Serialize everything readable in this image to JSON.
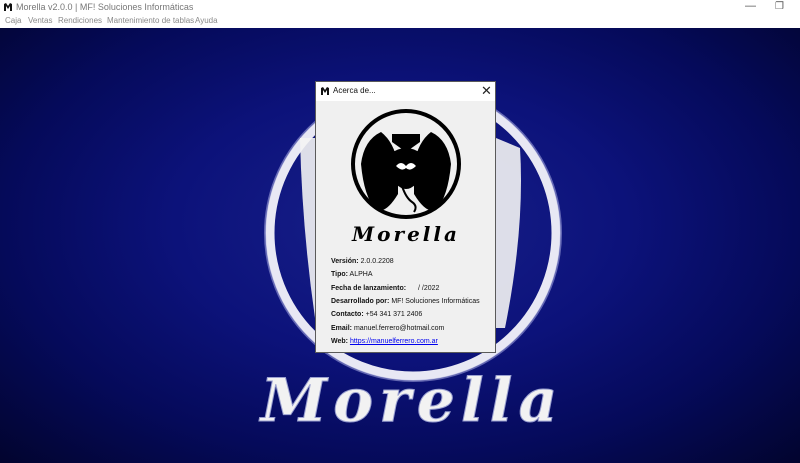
{
  "window": {
    "title": "Morella v2.0.0    |    MF! Soluciones Informáticas",
    "minimize_glyph": "—",
    "maximize_glyph": "❐"
  },
  "menu": [
    {
      "label": "Caja"
    },
    {
      "label": "Ventas"
    },
    {
      "label": "Rendiciones"
    },
    {
      "label": "Mantenimiento de tablas"
    },
    {
      "label": "Ayuda"
    }
  ],
  "background": {
    "brand_text": "Morella",
    "colors": {
      "blue_center": "#18208a",
      "blue_edge": "#02042e",
      "ring": "#ffffff"
    }
  },
  "dialog": {
    "title": "Acerca de...",
    "close_glyph": "✕",
    "logo_text": "Morella",
    "fields": [
      {
        "label": "Versión:",
        "value": "2.0.0.2208"
      },
      {
        "label": "Tipo:",
        "value": "ALPHA"
      },
      {
        "label": "Fecha de lanzamiento:",
        "value": "/      /2022"
      },
      {
        "label": "Desarrollado por:",
        "value": "MF! Soluciones Informáticas"
      },
      {
        "label": "Contacto:",
        "value": "+54 341 371 2406"
      },
      {
        "label": "Email:",
        "value": "manuel.ferrero@hotmail.com"
      },
      {
        "label": "Web:",
        "value": "https://manuelferrero.com.ar"
      }
    ]
  }
}
